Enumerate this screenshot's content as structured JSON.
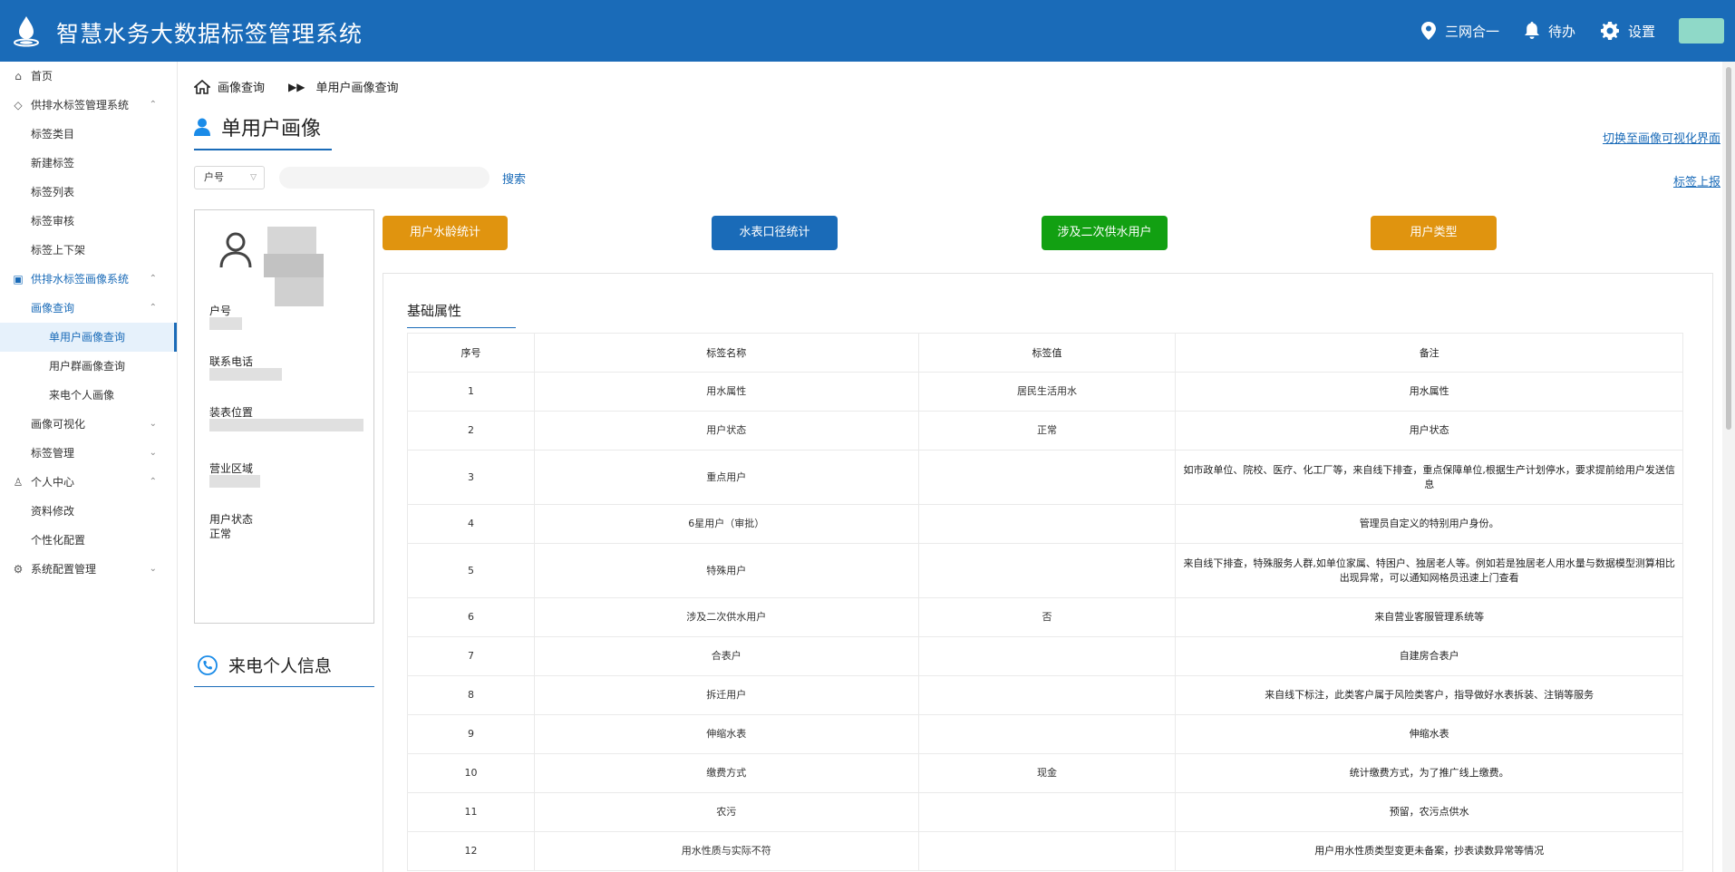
{
  "header": {
    "title": "智慧水务大数据标签管理系统",
    "nav": [
      {
        "icon": "location-pin-icon",
        "label": "三网合一"
      },
      {
        "icon": "bell-icon",
        "label": "待办"
      },
      {
        "icon": "gear-icon",
        "label": "设置"
      }
    ]
  },
  "sidebar": {
    "items": [
      {
        "label": "首页",
        "icon": "home-icon"
      },
      {
        "label": "供排水标签管理系统",
        "icon": "tag-icon",
        "chevron": "⌃"
      },
      {
        "label": "标签类目"
      },
      {
        "label": "新建标签"
      },
      {
        "label": "标签列表"
      },
      {
        "label": "标签审核"
      },
      {
        "label": "标签上下架"
      },
      {
        "label": "供排水标签画像系统",
        "icon": "picture-icon",
        "chevron": "⌃"
      },
      {
        "label": "画像查询",
        "chevron": "⌃"
      },
      {
        "label": "单用户画像查询"
      },
      {
        "label": "用户群画像查询"
      },
      {
        "label": "来电个人画像"
      },
      {
        "label": "画像可视化",
        "chevron": "⌄"
      },
      {
        "label": "标签管理",
        "chevron": "⌄"
      },
      {
        "label": "个人中心",
        "icon": "user-icon",
        "chevron": "⌃"
      },
      {
        "label": "资料修改"
      },
      {
        "label": "个性化配置"
      },
      {
        "label": "系统配置管理",
        "icon": "gear-icon",
        "chevron": "⌄"
      }
    ]
  },
  "breadcrumb": {
    "items": [
      "画像查询",
      "单用户画像查询"
    ]
  },
  "page": {
    "title": "单用户画像",
    "switch_link": "切换至画像可视化界面",
    "report_link": "标签上报"
  },
  "search": {
    "select_value": "户号",
    "button": "搜索"
  },
  "user_card": {
    "fields": [
      "户号",
      "联系电话",
      "装表位置",
      "营业区域",
      "用户状态"
    ],
    "status_value": "正常"
  },
  "call_info": {
    "title": "来电个人信息"
  },
  "tag_buttons": [
    {
      "label": "用户水龄统计",
      "color": "#e0940f"
    },
    {
      "label": "水表口径统计",
      "color": "#1a6bb8"
    },
    {
      "label": "涉及二次供水用户",
      "color": "#12a012"
    },
    {
      "label": "用户类型",
      "color": "#e0940f"
    }
  ],
  "attributes": {
    "title": "基础属性",
    "columns": [
      "序号",
      "标签名称",
      "标签值",
      "备注"
    ],
    "rows": [
      [
        "1",
        "用水属性",
        "居民生活用水",
        "用水属性"
      ],
      [
        "2",
        "用户状态",
        "正常",
        "用户状态"
      ],
      [
        "3",
        "重点用户",
        "",
        "如市政单位、院校、医疗、化工厂等，来自线下排查，重点保障单位,根据生产计划停水，要求提前给用户发送信息"
      ],
      [
        "4",
        "6星用户（审批）",
        "",
        "管理员自定义的特别用户身份。"
      ],
      [
        "5",
        "特殊用户",
        "",
        "来自线下排查，特殊服务人群,如单位家属、特困户、独居老人等。例如若是独居老人用水量与数据模型测算相比出现异常，可以通知网格员迅速上门查看"
      ],
      [
        "6",
        "涉及二次供水用户",
        "否",
        "来自营业客服管理系统等"
      ],
      [
        "7",
        "合表户",
        "",
        "自建房合表户"
      ],
      [
        "8",
        "拆迁用户",
        "",
        "来自线下标注，此类客户属于风险类客户，指导做好水表拆装、注销等服务"
      ],
      [
        "9",
        "伸缩水表",
        "",
        "伸缩水表"
      ],
      [
        "10",
        "缴费方式",
        "现金",
        "统计缴费方式，为了推广线上缴费。"
      ],
      [
        "11",
        "农污",
        "",
        "预留，农污点供水"
      ],
      [
        "12",
        "用水性质与实际不符",
        "",
        "用户用水性质类型变更未备案，抄表读数异常等情况"
      ]
    ]
  }
}
